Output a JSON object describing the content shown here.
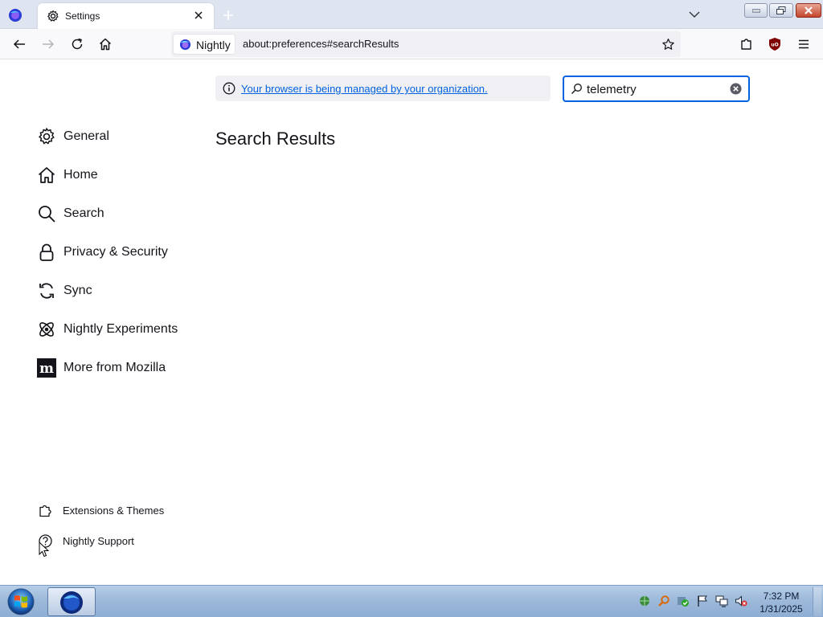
{
  "window": {
    "tab_title": "Settings",
    "new_tab_icon": "plus-icon",
    "list_all_tabs_icon": "chevron-down-icon"
  },
  "nav": {
    "identity_label": "Nightly",
    "url": "about:preferences#searchResults"
  },
  "policy": {
    "link_text": "Your browser is being managed by your organization."
  },
  "search": {
    "value": "telemetry"
  },
  "main": {
    "title": "Search Results"
  },
  "sidebar": {
    "categories": [
      {
        "label": "General",
        "icon": "gear-icon"
      },
      {
        "label": "Home",
        "icon": "home-icon"
      },
      {
        "label": "Search",
        "icon": "search-icon"
      },
      {
        "label": "Privacy & Security",
        "icon": "lock-icon"
      },
      {
        "label": "Sync",
        "icon": "sync-icon"
      },
      {
        "label": "Nightly Experiments",
        "icon": "experiments-icon"
      },
      {
        "label": "More from Mozilla",
        "icon": "mozilla-icon"
      }
    ],
    "footer": [
      {
        "label": "Extensions & Themes",
        "icon": "puzzle-icon"
      },
      {
        "label": "Nightly Support",
        "icon": "help-icon"
      }
    ]
  },
  "taskbar": {
    "time": "7:32 PM",
    "date": "1/31/2025"
  },
  "colors": {
    "accent": "#0061e0",
    "tabstrip": "#dfe5f0",
    "taskbar": "#9db9da"
  }
}
